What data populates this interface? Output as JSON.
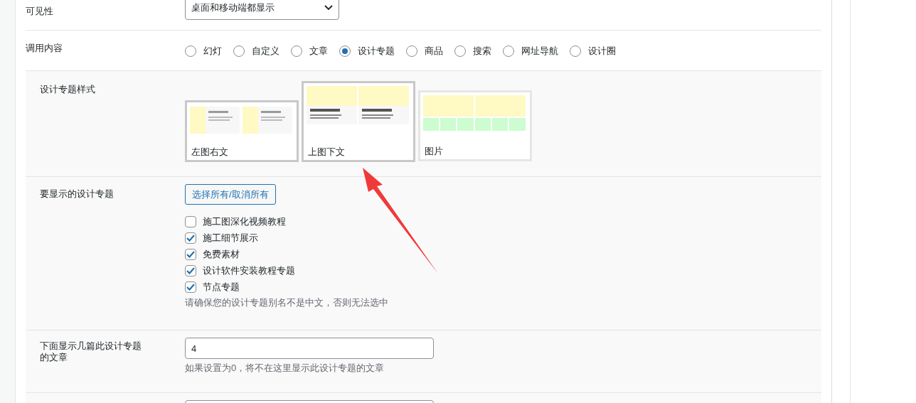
{
  "visibility": {
    "label": "可见性",
    "value": "桌面和移动端都显示"
  },
  "content_source": {
    "label": "调用内容",
    "options": [
      {
        "label": "幻灯",
        "selected": false
      },
      {
        "label": "自定义",
        "selected": false
      },
      {
        "label": "文章",
        "selected": false
      },
      {
        "label": "设计专题",
        "selected": true
      },
      {
        "label": "商品",
        "selected": false
      },
      {
        "label": "搜索",
        "selected": false
      },
      {
        "label": "网址导航",
        "selected": false
      },
      {
        "label": "设计圈",
        "selected": false
      }
    ]
  },
  "topic_style": {
    "label": "设计专题样式",
    "options": [
      {
        "kind": "left-image",
        "label": "左图右文",
        "selected": false
      },
      {
        "kind": "top-image",
        "label": "上图下文",
        "selected": true
      },
      {
        "kind": "image",
        "label": "图片",
        "selected": false
      }
    ]
  },
  "topics": {
    "label": "要显示的设计专题",
    "toggle_button": "选择所有/取消所有",
    "items": [
      {
        "label": "施工图深化视频教程",
        "checked": false
      },
      {
        "label": "施工细节展示",
        "checked": true
      },
      {
        "label": "免费素材",
        "checked": true
      },
      {
        "label": "设计软件安装教程专题",
        "checked": true
      },
      {
        "label": "节点专题",
        "checked": true
      }
    ],
    "hint": "请确保您的设计专题别名不是中文，否则无法选中"
  },
  "post_count": {
    "label": "下面显示几篇此设计专题的文章",
    "value": "4",
    "hint": "如果设置为0，将不在这里显示此设计专题的文章"
  }
}
